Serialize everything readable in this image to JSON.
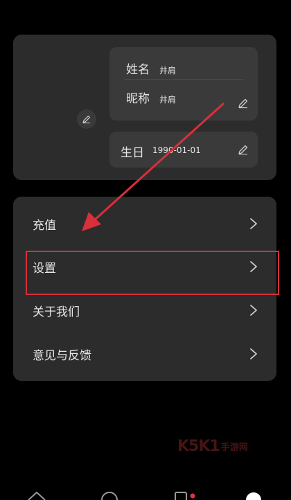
{
  "profile": {
    "name_label": "姓名",
    "name_value": "井肩",
    "nickname_label": "昵称",
    "nickname_value": "井肩",
    "birthday_label": "生日",
    "birthday_value": "1990-01-01"
  },
  "menu": {
    "items": [
      {
        "label": "充值"
      },
      {
        "label": "设置"
      },
      {
        "label": "关于我们"
      },
      {
        "label": "意见与反馈"
      }
    ]
  },
  "watermark": {
    "mark": "K5K1",
    "text": "手游网"
  },
  "colors": {
    "background": "#000000",
    "card": "#2c2c2c",
    "field": "#3a3a3a",
    "annotation_red": "#d8303a"
  }
}
